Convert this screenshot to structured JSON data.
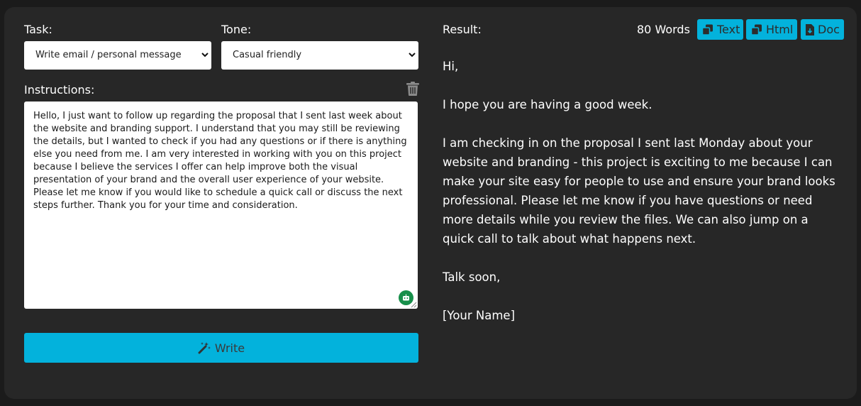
{
  "form": {
    "task_label": "Task:",
    "task_value": "Write email / personal message",
    "tone_label": "Tone:",
    "tone_value": "Casual friendly",
    "instructions_label": "Instructions:",
    "instructions_text": "Hello, I just want to follow up regarding the proposal that I sent last week about the website and branding support. I understand that you may still be reviewing the details, but I wanted to check if you had any questions or if there is anything else you need from me. I am very interested in working with you on this project because I believe the services I offer can help improve both the visual presentation of your brand and the overall user experience of your website. Please let me know if you would like to schedule a quick call or discuss the next steps further. Thank you for your time and consideration.",
    "write_label": "Write"
  },
  "result": {
    "label": "Result:",
    "word_count": "80 Words",
    "buttons": {
      "text": "Text",
      "html": "Html",
      "doc": "Doc"
    },
    "paragraphs": [
      "Hi,",
      "I hope you are having a good week.",
      "I am checking in on the proposal I sent last Monday about your website and branding - this project is exciting to me because I can make your site easy for people to use and ensure your brand looks professional. Please let me know if you have questions or need more details while you review the files. We can also jump on a quick call to talk about what happens next.",
      "Talk soon,",
      "[Your Name]"
    ]
  },
  "colors": {
    "accent": "#03b2dc",
    "panel": "#272727",
    "background": "#1b1b1b",
    "badge": "#178f4a"
  },
  "icons": [
    "chevron-down-icon",
    "trash-icon",
    "robot-icon",
    "resize-grip-icon",
    "magic-wand-icon",
    "copy-icon",
    "download-file-icon"
  ]
}
